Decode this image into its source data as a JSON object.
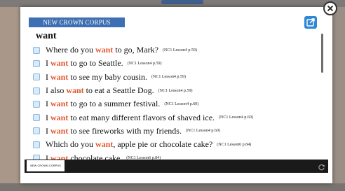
{
  "corpus_label": "NEW CROWN CORPUS",
  "keyword": "want",
  "player_tag": "NEW CROWN CORPUS",
  "rows": [
    {
      "before": "Where do you ",
      "hl": "want",
      "after": " to go, Mark?",
      "ref": "(NC1 Lesson4 p.59)"
    },
    {
      "before": "I ",
      "hl": "want",
      "after": " to go to Seattle.",
      "ref": "(NC1 Lesson4 p.59)"
    },
    {
      "before": "I ",
      "hl": "want",
      "after": " to see my baby cousin.",
      "ref": "(NC1 Lesson4 p.59)"
    },
    {
      "before": "I also ",
      "hl": "want",
      "after": " to eat a Seattle Dog.",
      "ref": "(NC1 Lesson4 p.59)"
    },
    {
      "before": "I ",
      "hl": "want",
      "after": " to go to a summer festival.",
      "ref": "(NC1 Lesson4 p.60)"
    },
    {
      "before": "I ",
      "hl": "want",
      "after": " to eat many different flavors of shaved ice.",
      "ref": "(NC1 Lesson4 p.60)"
    },
    {
      "before": "I ",
      "hl": "want",
      "after": " to see fireworks with my friends.",
      "ref": "(NC1 Lesson4 p.60)"
    },
    {
      "before": "Which do you ",
      "hl": "want",
      "after": ", apple pie or chocolate cake?",
      "ref": "(NC1 Lesson6 p.84)"
    },
    {
      "before": "I ",
      "hl": "want",
      "after": " chocolate cake.",
      "ref": "(NC1 Lesson6 p.84)"
    }
  ],
  "icons": {
    "close": "close-icon",
    "export": "export-icon",
    "replay": "replay-icon"
  },
  "colors": {
    "highlight": "#e4572e",
    "label_bg": "#3f6fb3",
    "export_bg": "#2f87d6",
    "player_bg": "#1a1a1a"
  }
}
